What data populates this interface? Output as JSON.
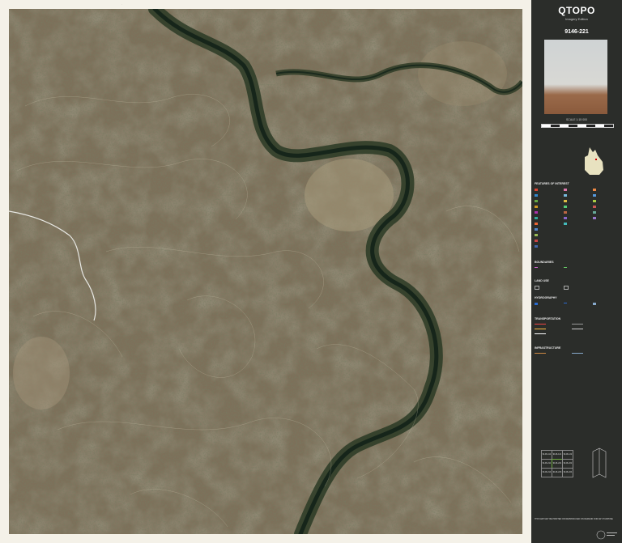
{
  "panel": {
    "title": "QTOPO",
    "subtitle": "Imagery Edition",
    "sheet_number": "9146-221",
    "scale": "SCALE 1:15 000",
    "legend_sections": [
      "FEATURES OF INTEREST",
      "BOUNDARIES",
      "LAND USE",
      "HYDROGRAPHY",
      "TRANSPORTATION",
      "INFRASTRUCTURE"
    ],
    "grid_sheets": [
      "9146-112",
      "9146-121",
      "9146-122",
      "9146-211",
      "9146-221",
      "9146-222",
      "9146-214",
      "9146-223",
      "9146-224"
    ],
    "disclaimer_heading": "THIS MAP MAY BE PRINTED OR REPRODUCED ON DEMAND FOR ANY PURPOSE"
  },
  "colors": {
    "frame": "#f4f1e8",
    "panel": "#2b2d2a",
    "terrain": "#7a6e58",
    "vegetation": "#3f4a2e",
    "river": "#1f3a27",
    "track": "#e6e6e6"
  }
}
